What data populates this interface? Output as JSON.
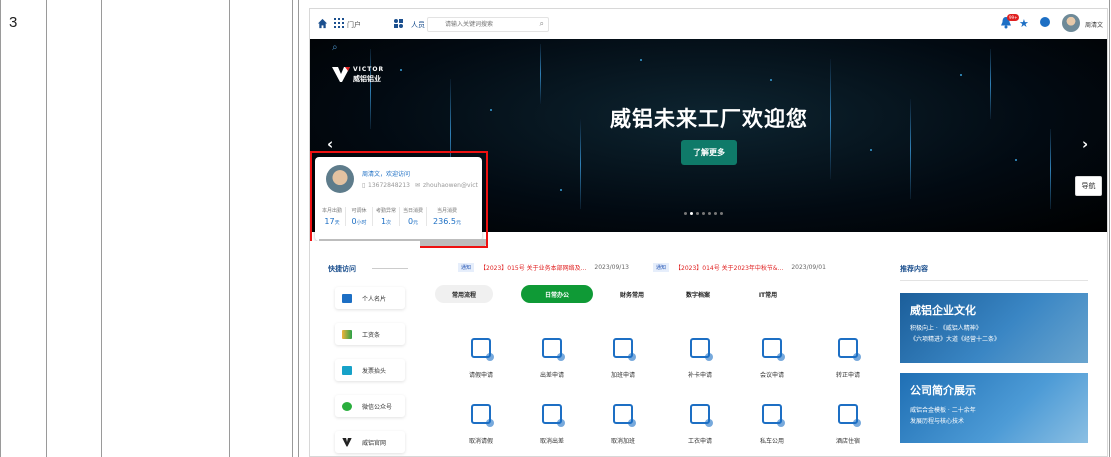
{
  "row": {
    "number": "3"
  },
  "topbar": {
    "portal": "门户",
    "search_category": "人员",
    "search_placeholder": "请输入关键词搜索",
    "badge": "99+",
    "username": "周清文"
  },
  "banner": {
    "logo_en": "VICTOR",
    "logo_cn": "威铝铝业",
    "title": "威铝未来工厂欢迎您",
    "button": "了解更多",
    "nav_tab": "导航"
  },
  "profile": {
    "greeting": "周清文，欢迎访问",
    "phone": "13672848213",
    "email": "zhouhaowen@vict",
    "stats": [
      {
        "label": "本月出勤",
        "value": "17",
        "unit": "天"
      },
      {
        "label": "可调休",
        "value": "0",
        "unit": "小时"
      },
      {
        "label": "考勤异常",
        "value": "1",
        "unit": "次"
      },
      {
        "label": "当日消费",
        "value": "0",
        "unit": "元"
      },
      {
        "label": "当月消费",
        "value": "236.5",
        "unit": "元"
      }
    ]
  },
  "quick": {
    "title": "快捷访问",
    "items": [
      "个人名片",
      "工资条",
      "发票抬头",
      "微信公众号",
      "威铝官网"
    ]
  },
  "notices": [
    {
      "tag": "通知",
      "text": "【2023】015号 关于业务本部网络及...",
      "date": "2023/09/13"
    },
    {
      "tag": "通知",
      "text": "【2023】014号 关于2023年中秋节&...",
      "date": "2023/09/01"
    }
  ],
  "tabs": [
    "常用流程",
    "日常办公",
    "财务常用",
    "数字档案",
    "IT常用"
  ],
  "apps": [
    "请假申请",
    "出差申请",
    "加班申请",
    "补卡申请",
    "会议申请",
    "转正申请",
    "取消请假",
    "取消出差",
    "取消加班",
    "工衣申请",
    "私车公用",
    "酒店住宿"
  ],
  "recommend": {
    "title": "推荐内容",
    "card1_title": "威铝企业文化",
    "card1_sub": "积极向上 · 《威铝人精神》",
    "card1_sub2": "《六项精进》大道《经营十二条》",
    "card2_title": "公司简介展示",
    "card2_sub": "威铝合金模板 · 二十余年",
    "card2_sub2": "发展历程与核心技术"
  }
}
